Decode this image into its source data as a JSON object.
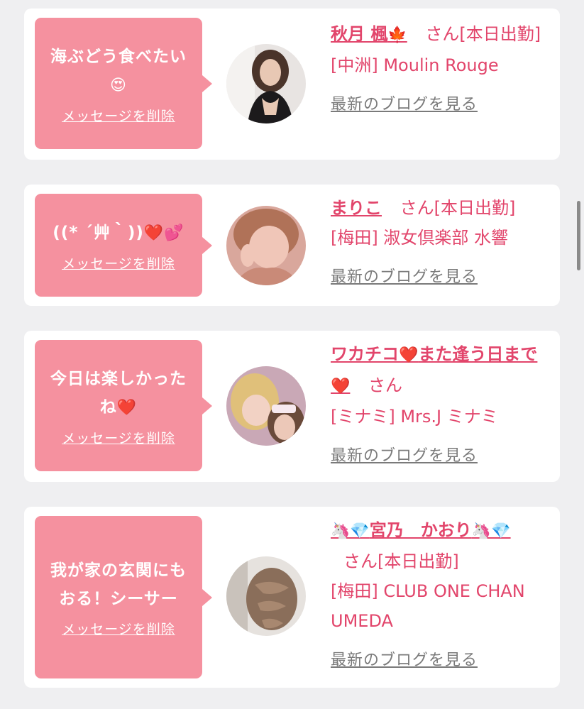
{
  "cards": [
    {
      "message": "海ぶどう食べたい",
      "message_emoji": "😍",
      "delete_label": "メッセージを削除",
      "name": "秋月 楓",
      "name_emoji": "🍁",
      "suffix": "さん[本日出勤]",
      "shop": "[中洲] Moulin Rouge",
      "blog_label": "最新のブログを見る"
    },
    {
      "message": "((* ´艸｀))",
      "message_emoji": "❤️💕",
      "delete_label": "メッセージを削除",
      "name": "まりこ",
      "suffix": "さん[本日出勤]",
      "shop": "[梅田] 淑女倶楽部 水響",
      "blog_label": "最新のブログを見る"
    },
    {
      "message": "今日は楽しかったね",
      "message_emoji": "❤️",
      "delete_label": "メッセージを削除",
      "name_part1": "ワカチコ",
      "name_part2": "また逢う日まで",
      "name_emoji": "❤️",
      "suffix": "さん",
      "shop": "[ミナミ] Mrs.J ミナミ",
      "blog_label": "最新のブログを見る"
    },
    {
      "message": "我が家の玄関にもおる！シーサー",
      "delete_label": "メッセージを削除",
      "name_prefix_emoji": "🦄💎",
      "name": "宮乃　かおり",
      "name_suffix_emoji": "🦄💎",
      "suffix": "さん[本日出勤]",
      "shop": "[梅田] CLUB ONE CHAN UMEDA",
      "blog_label": "最新のブログを見る"
    }
  ],
  "colors": {
    "bubble": "#f5919f",
    "name": "#e2456b",
    "background": "#efeff1"
  }
}
